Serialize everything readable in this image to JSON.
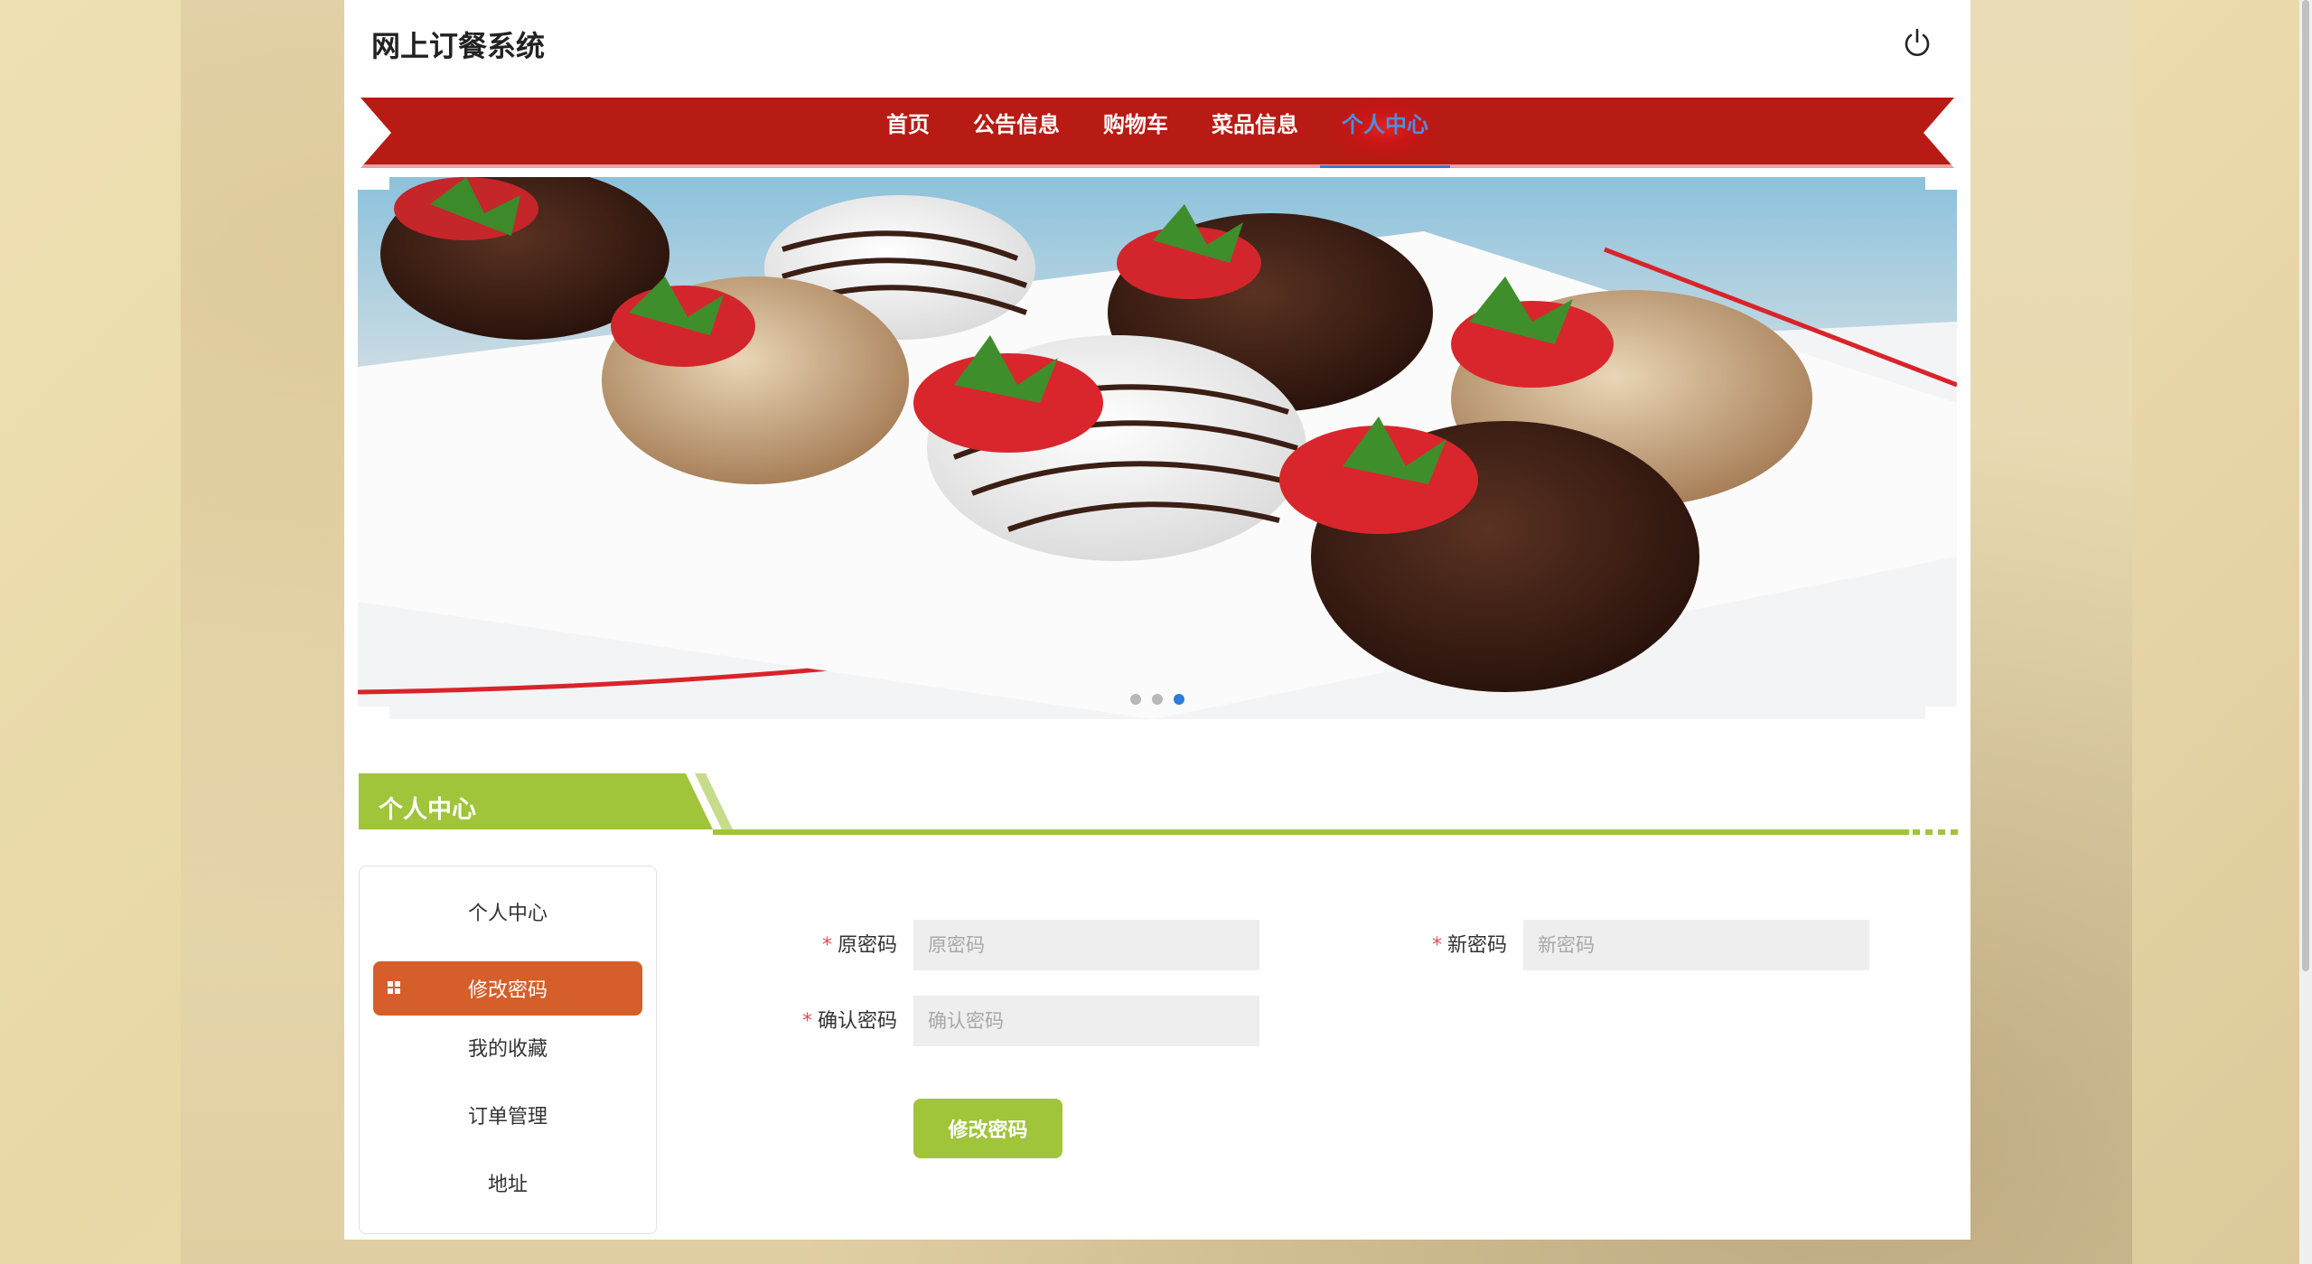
{
  "header": {
    "site_title": "网上订餐系统",
    "power_icon": "power-icon"
  },
  "nav": {
    "items": [
      {
        "label": "首页"
      },
      {
        "label": "公告信息"
      },
      {
        "label": "购物车"
      },
      {
        "label": "菜品信息"
      },
      {
        "label": "个人中心",
        "active": true
      }
    ]
  },
  "banner": {
    "dots": 3,
    "active_dot": 3
  },
  "section": {
    "title": "个人中心"
  },
  "sidebar": {
    "items": [
      {
        "label": "个人中心"
      },
      {
        "label": "修改密码",
        "active": true
      },
      {
        "label": "我的收藏"
      },
      {
        "label": "订单管理"
      },
      {
        "label": "地址"
      }
    ]
  },
  "form": {
    "old_password": {
      "label": "原密码",
      "placeholder": "原密码",
      "value": ""
    },
    "new_password": {
      "label": "新密码",
      "placeholder": "新密码",
      "value": ""
    },
    "confirm_password": {
      "label": "确认密码",
      "placeholder": "确认密码",
      "value": ""
    },
    "required_mark": "*",
    "submit_label": "修改密码"
  },
  "colors": {
    "nav_red": "#b81a14",
    "accent_green": "#a0c43a",
    "sidebar_active": "#d65e2a",
    "nav_active_text": "#4a90e2"
  }
}
